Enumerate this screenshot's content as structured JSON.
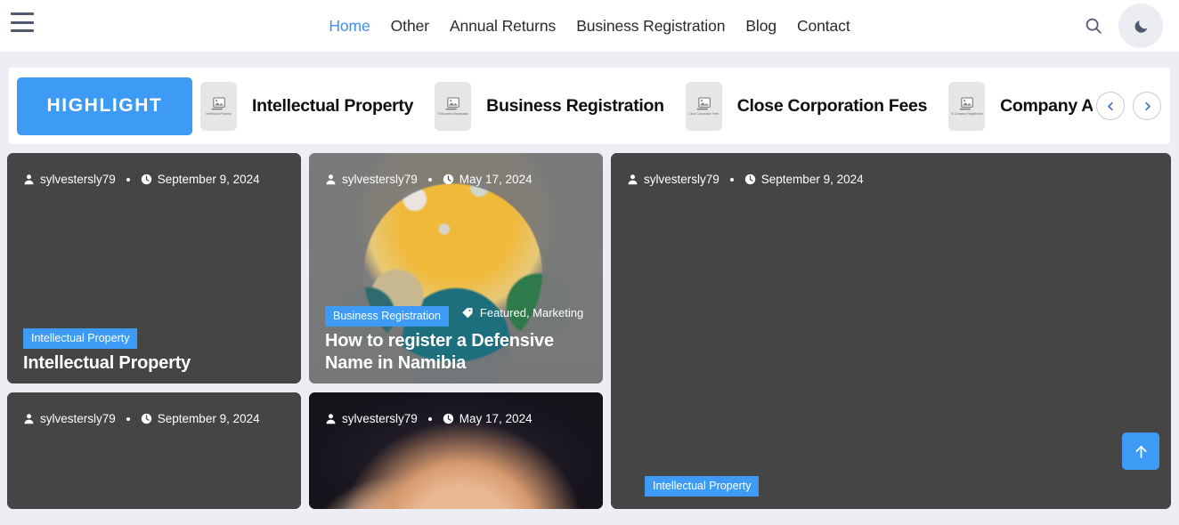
{
  "header": {
    "menu_icon": "hamburger-menu-icon",
    "nav": [
      {
        "label": "Home",
        "active": true
      },
      {
        "label": "Other",
        "active": false
      },
      {
        "label": "Annual Returns",
        "active": false
      },
      {
        "label": "Business Registration",
        "active": false
      },
      {
        "label": "Blog",
        "active": false
      },
      {
        "label": "Contact",
        "active": false
      }
    ],
    "search_icon": "search-icon",
    "theme_toggle_icon": "moon-icon"
  },
  "highlight": {
    "badge_label": "HIGHLIGHT",
    "items": [
      {
        "title": "Intellectual Property",
        "thumb_icon": "broken-image-icon",
        "alt_text": "Intellectual Property"
      },
      {
        "title": "Business Registration",
        "thumb_icon": "broken-image-icon",
        "alt_text": "To Business Registration"
      },
      {
        "title": "Close Corporation Fees",
        "thumb_icon": "broken-image-icon",
        "alt_text": "Close Corporation Fees"
      },
      {
        "title": "Company App",
        "thumb_icon": "broken-image-icon",
        "alt_text": "To Company Registration"
      }
    ],
    "prev_icon": "chevron-left-icon",
    "next_icon": "chevron-right-icon"
  },
  "colors": {
    "accent_blue": "#3d9bf5",
    "page_background": "#eceef4",
    "card_background": "#454545",
    "header_background": "#ffffff",
    "nav_active": "#3d8ef7"
  },
  "posts": [
    {
      "id": "post-intellectual-property-1",
      "author": "sylvestersly79",
      "author_icon": "user-icon",
      "date": "September 9, 2024",
      "date_icon": "clock-icon",
      "category": "Intellectual Property",
      "title": "Intellectual Property",
      "tags": "",
      "has_image": false
    },
    {
      "id": "post-defensive-name",
      "author": "sylvestersly79",
      "author_icon": "user-icon",
      "date": "May 17, 2024",
      "date_icon": "clock-icon",
      "category": "Business Registration",
      "title": "How to register a Defensive Name in Namibia",
      "tags": "Featured, Marketing",
      "tag_icon": "tag-icon",
      "has_image": true,
      "image_desc": "3d-planet-island-landscape"
    },
    {
      "id": "post-intellectual-property-2",
      "author": "sylvestersly79",
      "author_icon": "user-icon",
      "date": "September 9, 2024",
      "date_icon": "clock-icon",
      "category": "Intellectual Property",
      "title": "",
      "has_image": false
    },
    {
      "id": "post-bottom-left",
      "author": "sylvestersly79",
      "author_icon": "user-icon",
      "date": "September 9, 2024",
      "date_icon": "clock-icon",
      "category": "",
      "title": "",
      "has_image": false
    },
    {
      "id": "post-bottom-middle",
      "author": "sylvestersly79",
      "author_icon": "user-icon",
      "date": "May 17, 2024",
      "date_icon": "clock-icon",
      "category": "",
      "title": "",
      "has_image": true,
      "image_desc": "3d-vintage-camera"
    }
  ],
  "scroll_to_top": {
    "icon": "arrow-up-icon",
    "label": ""
  }
}
